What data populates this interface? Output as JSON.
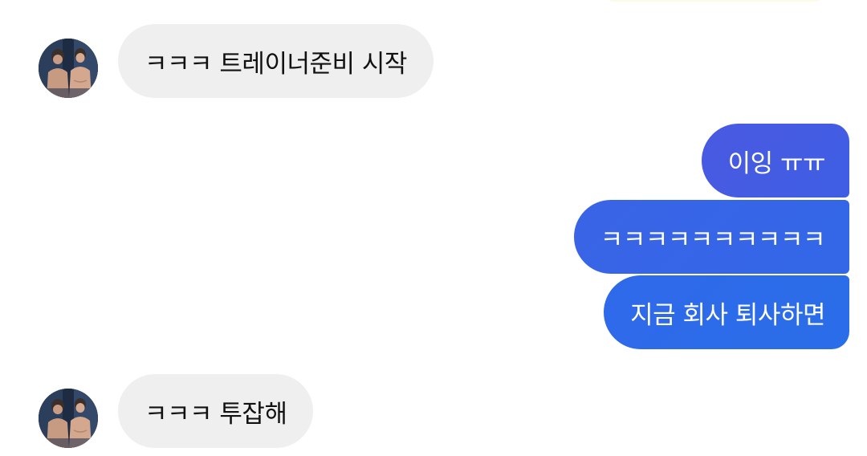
{
  "messages": [
    {
      "direction": "incoming",
      "text": "ㅋㅋㅋ 트레이너준비 시작"
    },
    {
      "direction": "outgoing",
      "text": "이잉 ㅠㅠ"
    },
    {
      "direction": "outgoing",
      "text": "ㅋㅋㅋㅋㅋㅋㅋㅋㅋㅋ"
    },
    {
      "direction": "outgoing",
      "text": "지금 회사 퇴사하면"
    },
    {
      "direction": "incoming",
      "text": "ㅋㅋㅋ 투잡해"
    }
  ],
  "colors": {
    "incoming_bubble": "#efefef",
    "incoming_text": "#111111",
    "outgoing_bubble_top": "#4a59e2",
    "outgoing_bubble_bottom": "#2a6de9",
    "outgoing_text": "#ffffff"
  }
}
